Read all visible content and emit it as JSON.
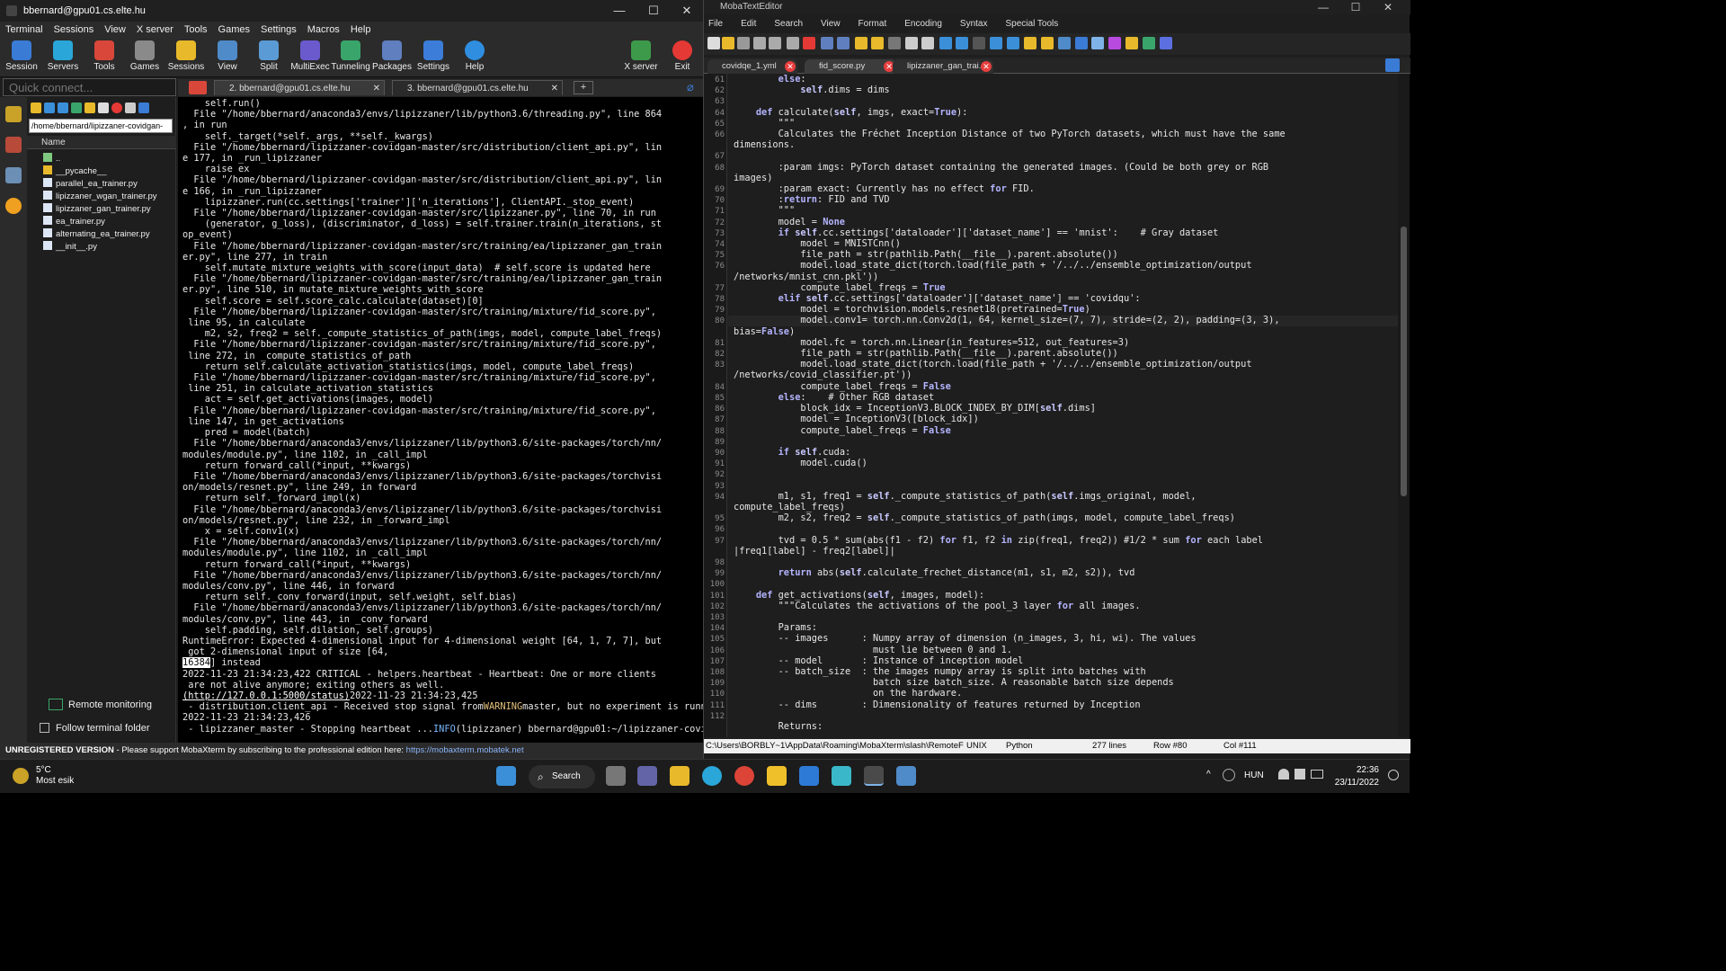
{
  "moba": {
    "title": "bbernard@gpu01.cs.elte.hu",
    "menu": [
      "Terminal",
      "Sessions",
      "View",
      "X server",
      "Tools",
      "Games",
      "Settings",
      "Macros",
      "Help"
    ],
    "toolbar": [
      "Session",
      "Servers",
      "Tools",
      "Games",
      "Sessions",
      "View",
      "Split",
      "MultiExec",
      "Tunneling",
      "Packages",
      "Settings",
      "Help"
    ],
    "toolbar_right": [
      "X server",
      "Exit"
    ],
    "quick_placeholder": "Quick connect...",
    "tabs": [
      "2. bbernard@gpu01.cs.elte.hu",
      "3. bbernard@gpu01.cs.elte.hu"
    ],
    "sftp": {
      "path": "/home/bbernard/lipizzaner-covidgan-",
      "header": "Name",
      "files": [
        "..",
        "__pycache__",
        "parallel_ea_trainer.py",
        "lipizzaner_wgan_trainer.py",
        "lipizzaner_gan_trainer.py",
        "ea_trainer.py",
        "alternating_ea_trainer.py",
        "__init__.py"
      ]
    },
    "remote_monitoring": "Remote monitoring",
    "follow_folder": "Follow terminal folder",
    "status": {
      "bold": "UNREGISTERED VERSION",
      "text": "  -  Please support MobaXterm by subscribing to the professional edition here: ",
      "link": "https://mobaxterm.mobatek.net"
    },
    "terminal_lines": [
      "    self.run()",
      "  File \"/home/bbernard/anaconda3/envs/lipizzaner/lib/python3.6/threading.py\", line 864",
      ", in run",
      "    self._target(*self._args, **self._kwargs)",
      "  File \"/home/bbernard/lipizzaner-covidgan-master/src/distribution/client_api.py\", lin",
      "e 177, in _run_lipizzaner",
      "    raise ex",
      "  File \"/home/bbernard/lipizzaner-covidgan-master/src/distribution/client_api.py\", lin",
      "e 166, in _run_lipizzaner",
      "    lipizzaner.run(cc.settings['trainer']['n_iterations'], ClientAPI._stop_event)",
      "  File \"/home/bbernard/lipizzaner-covidgan-master/src/lipizzaner.py\", line 70, in run",
      "    (generator, g_loss), (discriminator, d_loss) = self.trainer.train(n_iterations, st",
      "op_event)",
      "  File \"/home/bbernard/lipizzaner-covidgan-master/src/training/ea/lipizzaner_gan_train",
      "er.py\", line 277, in train",
      "    self.mutate_mixture_weights_with_score(input_data)  # self.score is updated here",
      "  File \"/home/bbernard/lipizzaner-covidgan-master/src/training/ea/lipizzaner_gan_train",
      "er.py\", line 510, in mutate_mixture_weights_with_score",
      "    self.score = self.score_calc.calculate(dataset)[0]",
      "  File \"/home/bbernard/lipizzaner-covidgan-master/src/training/mixture/fid_score.py\",",
      " line 95, in calculate",
      "    m2, s2, freq2 = self._compute_statistics_of_path(imgs, model, compute_label_freqs)",
      "  File \"/home/bbernard/lipizzaner-covidgan-master/src/training/mixture/fid_score.py\",",
      " line 272, in _compute_statistics_of_path",
      "    return self.calculate_activation_statistics(imgs, model, compute_label_freqs)",
      "  File \"/home/bbernard/lipizzaner-covidgan-master/src/training/mixture/fid_score.py\",",
      " line 251, in calculate_activation_statistics",
      "    act = self.get_activations(images, model)",
      "  File \"/home/bbernard/lipizzaner-covidgan-master/src/training/mixture/fid_score.py\",",
      " line 147, in get_activations",
      "    pred = model(batch)",
      "  File \"/home/bbernard/anaconda3/envs/lipizzaner/lib/python3.6/site-packages/torch/nn/",
      "modules/module.py\", line 1102, in _call_impl",
      "    return forward_call(*input, **kwargs)",
      "  File \"/home/bbernard/anaconda3/envs/lipizzaner/lib/python3.6/site-packages/torchvisi",
      "on/models/resnet.py\", line 249, in forward",
      "    return self._forward_impl(x)",
      "  File \"/home/bbernard/anaconda3/envs/lipizzaner/lib/python3.6/site-packages/torchvisi",
      "on/models/resnet.py\", line 232, in _forward_impl",
      "    x = self.conv1(x)",
      "  File \"/home/bbernard/anaconda3/envs/lipizzaner/lib/python3.6/site-packages/torch/nn/",
      "modules/module.py\", line 1102, in _call_impl",
      "    return forward_call(*input, **kwargs)",
      "  File \"/home/bbernard/anaconda3/envs/lipizzaner/lib/python3.6/site-packages/torch/nn/",
      "modules/conv.py\", line 446, in forward",
      "    return self._conv_forward(input, self.weight, self.bias)",
      "  File \"/home/bbernard/anaconda3/envs/lipizzaner/lib/python3.6/site-packages/torch/nn/",
      "modules/conv.py\", line 443, in _conv_forward",
      "    self.padding, self.dilation, self.groups)",
      "RuntimeError: Expected 4-dimensional input for 4-dimensional weight [64, 1, 7, 7], but",
      " got 2-dimensional input of size [64, ",
      "",
      "2022-11-23 21:34:23,422 CRITICAL - helpers.heartbeat - Heartbeat: One or more clients",
      " are not alive anymore; exiting others as well.",
      "2022-11-23 21:34:23,425 ",
      " - distribution.client_api - Received stop signal from",
      "master, but no experiment is running.",
      "2022-11-23 21:34:23,426 ",
      " - lipizzaner_master - Stopping heartbeat ...",
      "(lipizzaner) bbernard@gpu01:~/lipizzaner-covidgan-master/src$ "
    ],
    "terminal_selected": "16384",
    "terminal_after_sel": "] instead",
    "terminal_link": "(http://127.0.0.1:5000/status)",
    "terminal_warning": "WARNING",
    "terminal_info": "INFO"
  },
  "editor": {
    "title": "MobaTextEditor",
    "menu": [
      "File",
      "Edit",
      "Search",
      "View",
      "Format",
      "Encoding",
      "Syntax",
      "Special Tools"
    ],
    "tabs": [
      "covidqe_1.yml",
      "fid_score.py",
      "lipizzaner_gan_trai..."
    ],
    "line_start": 61,
    "line_end": 112,
    "code_lines": [
      "        else:",
      "            self.dims = dims",
      "",
      "    def calculate(self, imgs, exact=True):",
      "        \"\"\"",
      "        Calculates the Fréchet Inception Distance of two PyTorch datasets, which must have the same",
      "dimensions.",
      "",
      "        :param imgs: PyTorch dataset containing the generated images. (Could be both grey or RGB",
      "images)",
      "        :param exact: Currently has no effect for FID.",
      "        :return: FID and TVD",
      "        \"\"\"",
      "        model = None",
      "        if self.cc.settings['dataloader']['dataset_name'] == 'mnist':    # Gray dataset",
      "            model = MNISTCnn()",
      "            file_path = str(pathlib.Path(__file__).parent.absolute())",
      "            model.load_state_dict(torch.load(file_path + '/../../ensemble_optimization/output",
      "/networks/mnist_cnn.pkl'))",
      "            compute_label_freqs = True",
      "        elif self.cc.settings['dataloader']['dataset_name'] == 'covidqu':",
      "            model = torchvision.models.resnet18(pretrained=True)",
      "            model.conv1= torch.nn.Conv2d(1, 64, kernel_size=(7, 7), stride=(2, 2), padding=(3, 3),",
      "bias=False)",
      "            model.fc = torch.nn.Linear(in_features=512, out_features=3)",
      "            file_path = str(pathlib.Path(__file__).parent.absolute())",
      "            model.load_state_dict(torch.load(file_path + '/../../ensemble_optimization/output",
      "/networks/covid_classifier.pt'))",
      "            compute_label_freqs = False",
      "        else:    # Other RGB dataset",
      "            block_idx = InceptionV3.BLOCK_INDEX_BY_DIM[self.dims]",
      "            model = InceptionV3([block_idx])",
      "            compute_label_freqs = False",
      "",
      "        if self.cuda:",
      "            model.cuda()",
      "",
      "",
      "        m1, s1, freq1 = self._compute_statistics_of_path(self.imgs_original, model,",
      "compute_label_freqs)",
      "        m2, s2, freq2 = self._compute_statistics_of_path(imgs, model, compute_label_freqs)",
      "",
      "        tvd = 0.5 * sum(abs(f1 - f2) for f1, f2 in zip(freq1, freq2)) #1/2 * sum for each label",
      "|freq1[label] - freq2[label]|",
      "",
      "        return abs(self.calculate_frechet_distance(m1, s1, m2, s2)), tvd",
      "",
      "    def get_activations(self, images, model):",
      "        \"\"\"Calculates the activations of the pool_3 layer for all images.",
      "",
      "        Params:",
      "        -- images      : Numpy array of dimension (n_images, 3, hi, wi). The values",
      "                         must lie between 0 and 1.",
      "        -- model       : Instance of inception model",
      "        -- batch_size  : the images numpy array is split into batches with",
      "                         batch size batch_size. A reasonable batch size depends",
      "                         on the hardware.",
      "        -- dims        : Dimensionality of features returned by Inception",
      "",
      "        Returns:"
    ],
    "gutter": [
      "61",
      "62",
      "63",
      "64",
      "65",
      "66",
      "",
      "67",
      "68",
      "",
      "69",
      "70",
      "71",
      "72",
      "73",
      "74",
      "75",
      "76",
      "",
      "77",
      "78",
      "79",
      "80",
      "",
      "81",
      "82",
      "83",
      "",
      "84",
      "85",
      "86",
      "87",
      "88",
      "89",
      "90",
      "91",
      "92",
      "93",
      "94",
      "",
      "95",
      "96",
      "97",
      "",
      "98",
      "99",
      "100",
      "101",
      "102",
      "103",
      "104",
      "105",
      "106",
      "107",
      "108",
      "109",
      "110",
      "111",
      "112"
    ],
    "status": {
      "path": "C:\\Users\\BORBLY~1\\AppData\\Roaming\\MobaXterm\\slash\\RemoteF",
      "eol": "UNIX",
      "lang": "Python",
      "lines": "277 lines",
      "row": "Row #80",
      "col": "Col #111"
    }
  },
  "taskbar": {
    "temp": "5°C",
    "weather": "Most esik",
    "search": "Search",
    "lang": "HUN",
    "time": "22:36",
    "date": "23/11/2022"
  }
}
